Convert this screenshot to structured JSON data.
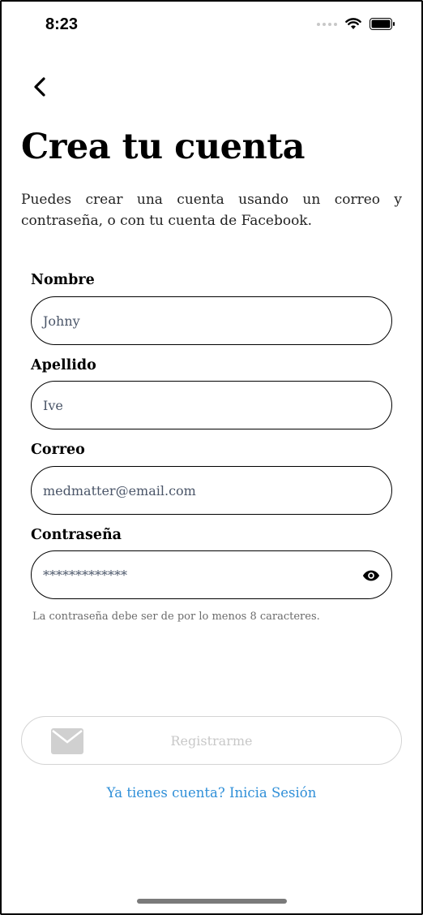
{
  "status_bar": {
    "time": "8:23"
  },
  "header": {
    "title": "Crea tu cuenta",
    "subtitle": "Puedes crear una cuenta usando un correo y contraseña, o con tu cuenta de Facebook."
  },
  "form": {
    "nombre": {
      "label": "Nombre",
      "value": "Johny"
    },
    "apellido": {
      "label": "Apellido",
      "value": "Ive"
    },
    "correo": {
      "label": "Correo",
      "value": "medmatter@email.com"
    },
    "contrasena": {
      "label": "Contraseña",
      "value": "*************",
      "hint": "La contraseña debe ser de por lo menos 8 caracteres."
    }
  },
  "actions": {
    "register_label": "Registrarme",
    "login_link": "Ya tienes cuenta? Inicia Sesión"
  },
  "colors": {
    "link": "#2f8fd8",
    "disabled": "#c8c8c8"
  }
}
